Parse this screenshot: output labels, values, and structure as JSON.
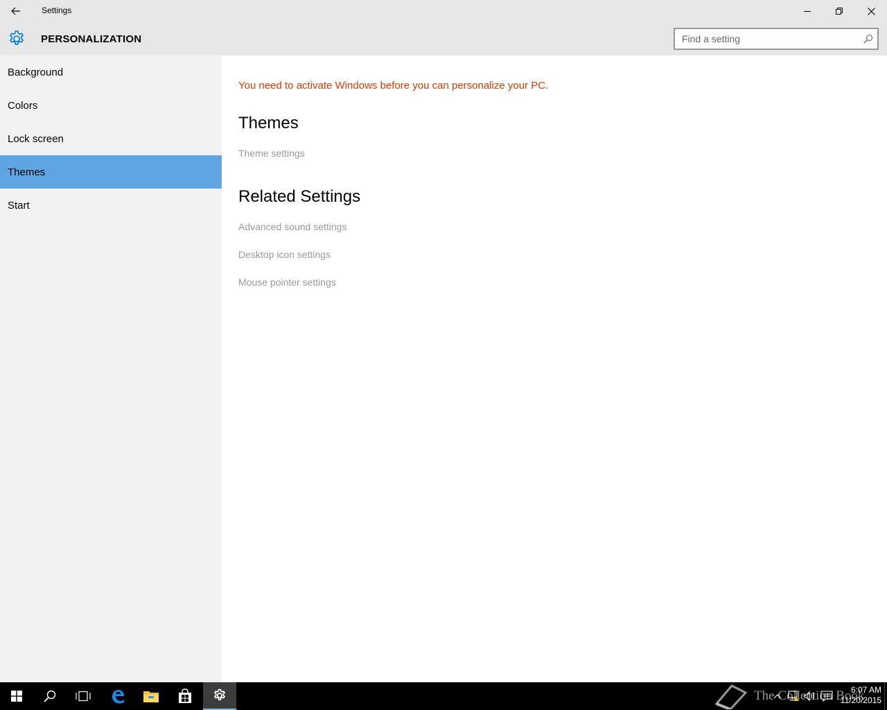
{
  "window": {
    "title": "Settings"
  },
  "header": {
    "section": "PERSONALIZATION",
    "search_placeholder": "Find a setting"
  },
  "sidebar": {
    "items": [
      {
        "label": "Background"
      },
      {
        "label": "Colors"
      },
      {
        "label": "Lock screen"
      },
      {
        "label": "Themes",
        "selected": true
      },
      {
        "label": "Start"
      }
    ]
  },
  "main": {
    "activation_notice": "You need to activate Windows before you can personalize your PC.",
    "themes_heading": "Themes",
    "themes_links": [
      "Theme settings"
    ],
    "related_heading": "Related Settings",
    "related_links": [
      "Advanced sound settings",
      "Desktop icon settings",
      "Mouse pointer settings"
    ]
  },
  "taskbar": {
    "apps": [
      "start-icon",
      "search-icon",
      "task-view-icon",
      "edge-icon",
      "file-explorer-icon",
      "store-icon",
      "settings-icon"
    ],
    "active_app": "settings-icon",
    "watermark": "The Collection Book",
    "time": "6:07 AM",
    "date": "11/20/2015"
  },
  "colors": {
    "titlebar_bg": "#e6e6e6",
    "sidebar_bg": "#f2f2f2",
    "selected_item": "#5ea5e2",
    "accent": "#0078d7",
    "warning_text": "#d83b01",
    "disabled_link": "#999999",
    "taskbar_bg": "#000000"
  }
}
